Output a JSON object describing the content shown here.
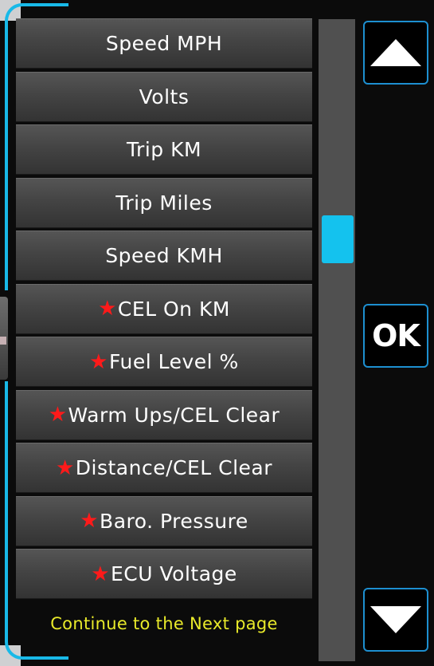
{
  "menu": {
    "items": [
      {
        "label": "Speed MPH",
        "starred": false
      },
      {
        "label": "Volts",
        "starred": false
      },
      {
        "label": "Trip KM",
        "starred": false
      },
      {
        "label": "Trip Miles",
        "starred": false
      },
      {
        "label": "Speed KMH",
        "starred": false
      },
      {
        "label": "CEL On KM",
        "starred": true
      },
      {
        "label": "Fuel Level %",
        "starred": true
      },
      {
        "label": "Warm Ups/CEL Clear",
        "starred": true
      },
      {
        "label": "Distance/CEL Clear",
        "starred": true
      },
      {
        "label": "Baro. Pressure",
        "starred": true
      },
      {
        "label": "ECU Voltage",
        "starred": true
      }
    ],
    "star_glyph": "★",
    "continue_text": "Continue to the Next page"
  },
  "scrollbar": {
    "position_fraction": 0.33
  },
  "buttons": {
    "up_icon": "triangle-up-icon",
    "ok_label": "OK",
    "down_icon": "triangle-down-icon"
  },
  "colors": {
    "accent": "#18b9e8",
    "star": "#ff1a1a",
    "continue_text": "#e9ea2a",
    "button_border": "#1d8fd0"
  }
}
